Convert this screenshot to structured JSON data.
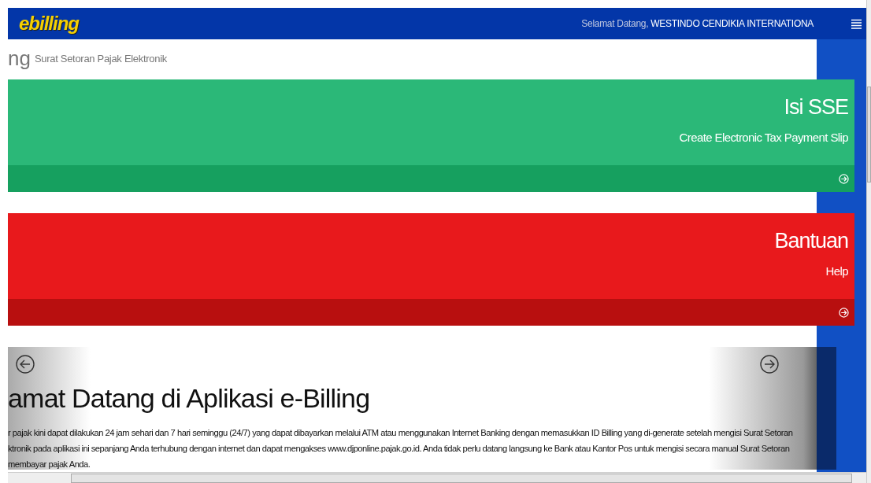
{
  "header": {
    "logo": "ebilling",
    "greeting": "Selamat Datang,",
    "user": "WESTINDO CENDIKIA INTERNATIONA"
  },
  "page_title": {
    "title": "ng",
    "subtitle": "Surat Setoran Pajak Elektronik"
  },
  "tiles": [
    {
      "kind": "green",
      "title": "Isi SSE",
      "subtitle": "Create Electronic Tax Payment Slip"
    },
    {
      "kind": "red",
      "title": "Bantuan",
      "subtitle": "Help"
    }
  ],
  "carousel": {
    "heading": "amat Datang di Aplikasi e-Billing",
    "lines": [
      "r pajak kini dapat dilakukan 24 jam sehari dan 7 hari seminggu (24/7) yang dapat dibayarkan melalui ATM atau menggunakan Internet Banking dengan memasukkan ID Billing yang di-generate setelah mengisi Surat Setoran",
      "ktronik pada aplikasi ini sepanjang Anda terhubung dengan internet dan dapat mengakses www.djponline.pajak.go.id. Anda tidak perlu datang langsung ke Bank atau Kantor Pos untuk mengisi secara manual Surat Setoran",
      "membayar pajak Anda."
    ]
  }
}
